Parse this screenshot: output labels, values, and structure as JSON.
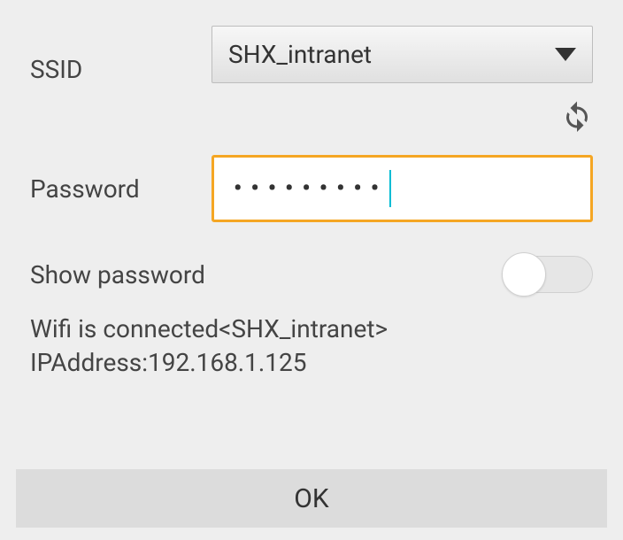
{
  "ssid": {
    "label": "SSID",
    "selected": "SHX_intranet"
  },
  "password": {
    "label": "Password",
    "masked_value": "•••••••••"
  },
  "show_password": {
    "label": "Show password",
    "enabled": false
  },
  "status": {
    "line1": "Wifi is connected<SHX_intranet>",
    "line2": "IPAddress:192.168.1.125"
  },
  "ok_button": {
    "label": "OK"
  }
}
